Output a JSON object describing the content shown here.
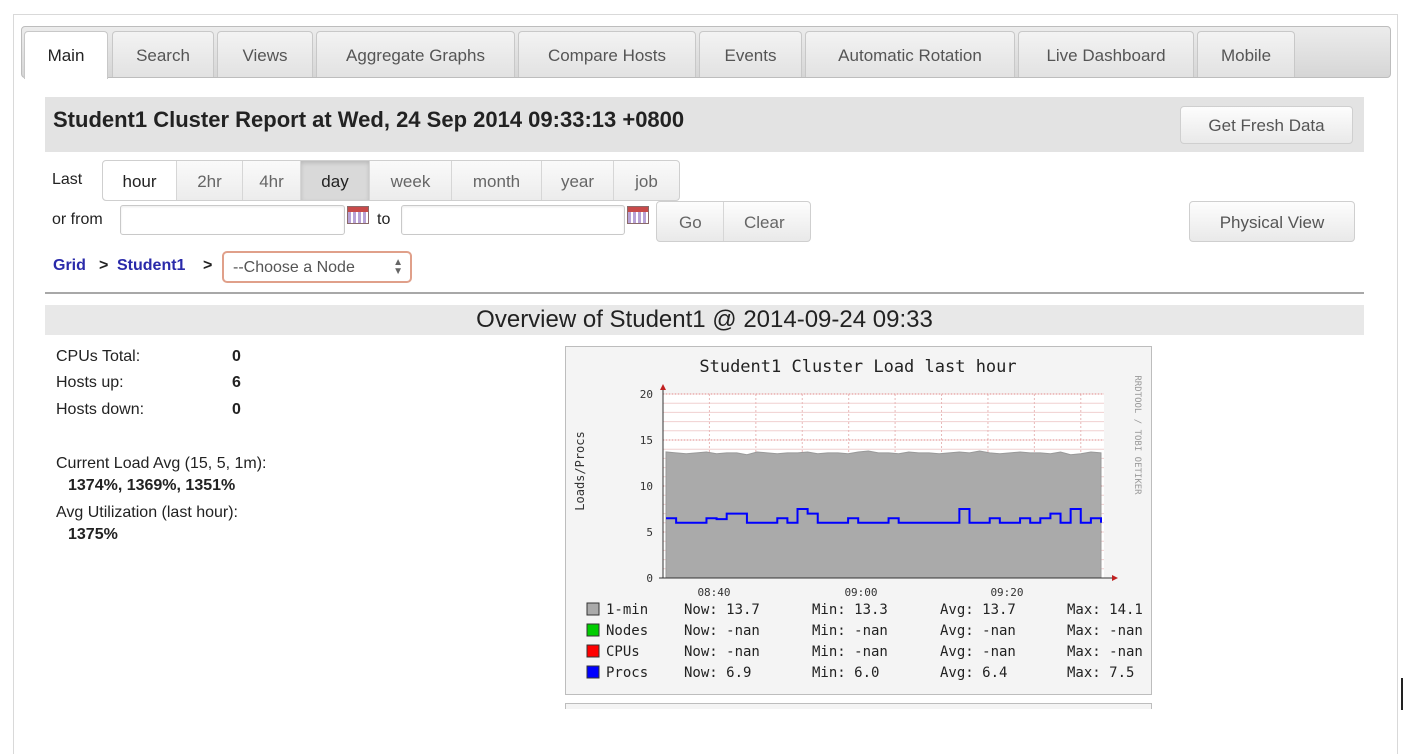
{
  "tabs": [
    {
      "label": "Main",
      "active": true
    },
    {
      "label": "Search"
    },
    {
      "label": "Views"
    },
    {
      "label": "Aggregate Graphs"
    },
    {
      "label": "Compare Hosts"
    },
    {
      "label": "Events"
    },
    {
      "label": "Automatic Rotation"
    },
    {
      "label": "Live Dashboard"
    },
    {
      "label": "Mobile"
    }
  ],
  "report": {
    "title": "Student1 Cluster Report at Wed, 24 Sep 2014 09:33:13 +0800",
    "fresh_button": "Get Fresh Data"
  },
  "range": {
    "last_label": "Last",
    "options": [
      "hour",
      "2hr",
      "4hr",
      "day",
      "week",
      "month",
      "year",
      "job"
    ],
    "selected": "day",
    "or_from_label": "or from",
    "to_label": "to",
    "from_value": "",
    "to_value": "",
    "go_label": "Go",
    "clear_label": "Clear",
    "physical_view_label": "Physical View"
  },
  "breadcrumb": {
    "grid": "Grid",
    "sep": ">",
    "cluster": "Student1",
    "node_select": "--Choose a Node"
  },
  "overview": {
    "title": "Overview of Student1 @ 2014-09-24 09:33",
    "cpus_total_label": "CPUs Total:",
    "cpus_total": "0",
    "hosts_up_label": "Hosts up:",
    "hosts_up": "6",
    "hosts_down_label": "Hosts down:",
    "hosts_down": "0",
    "load_avg_label": "Current Load Avg (15, 5, 1m):",
    "load_avg_value": "1374%, 1369%, 1351%",
    "util_label": "Avg Utilization (last hour):",
    "util_value": "1375%"
  },
  "chart_data": {
    "type": "area",
    "title": "Student1 Cluster Load last hour",
    "ylabel": "Loads/Procs",
    "watermark": "RRDTOOL / TOBI OETIKER",
    "ylim": [
      0,
      20
    ],
    "yticks": [
      "0",
      "5",
      "10",
      "15",
      "20"
    ],
    "xticks": [
      "08:40",
      "09:00",
      "09:20"
    ],
    "grid": true,
    "colors": {
      "1-min": "#aaaaaa",
      "Nodes": "#00cc00",
      "CPUs": "#ff0000",
      "Procs": "#0000ff"
    },
    "series": [
      {
        "name": "1-min",
        "values": [
          13.7,
          13.6,
          13.5,
          13.6,
          13.7,
          13.5,
          13.6,
          13.6,
          13.4,
          13.7,
          13.6,
          13.5,
          13.6,
          13.6,
          13.7,
          13.5,
          13.6,
          13.6,
          13.5,
          13.7,
          13.8,
          13.6,
          13.6,
          13.5,
          13.7,
          13.6,
          13.6,
          13.5,
          13.6,
          13.7,
          13.6,
          13.8,
          13.6,
          13.5,
          13.6,
          13.7,
          13.6,
          13.6,
          13.5,
          13.7,
          13.4,
          13.5,
          13.7,
          13.6
        ]
      },
      {
        "name": "Procs",
        "values": [
          6.5,
          6.0,
          6.0,
          6.0,
          6.5,
          6.4,
          7.0,
          7.0,
          6.0,
          6.0,
          6.0,
          6.5,
          6.0,
          7.5,
          7.0,
          6.0,
          6.0,
          6.0,
          6.5,
          6.0,
          6.0,
          6.0,
          6.5,
          6.0,
          6.0,
          6.0,
          6.0,
          6.0,
          6.0,
          7.5,
          6.0,
          6.0,
          6.5,
          6.0,
          6.0,
          6.5,
          6.0,
          6.5,
          7.0,
          6.0,
          7.5,
          6.0,
          6.5,
          6.0
        ]
      }
    ],
    "legend": [
      {
        "name": "1-min",
        "now": "Now: 13.7",
        "min": "Min: 13.3",
        "avg": "Avg: 13.7",
        "max": "Max: 14.1"
      },
      {
        "name": "Nodes",
        "now": "Now: -nan",
        "min": "Min: -nan",
        "avg": "Avg: -nan",
        "max": "Max: -nan"
      },
      {
        "name": "CPUs",
        "now": "Now: -nan",
        "min": "Min: -nan",
        "avg": "Avg: -nan",
        "max": "Max: -nan"
      },
      {
        "name": "Procs",
        "now": "Now:  6.9",
        "min": "Min:  6.0",
        "avg": "Avg:  6.4",
        "max": "Max:  7.5"
      }
    ]
  }
}
